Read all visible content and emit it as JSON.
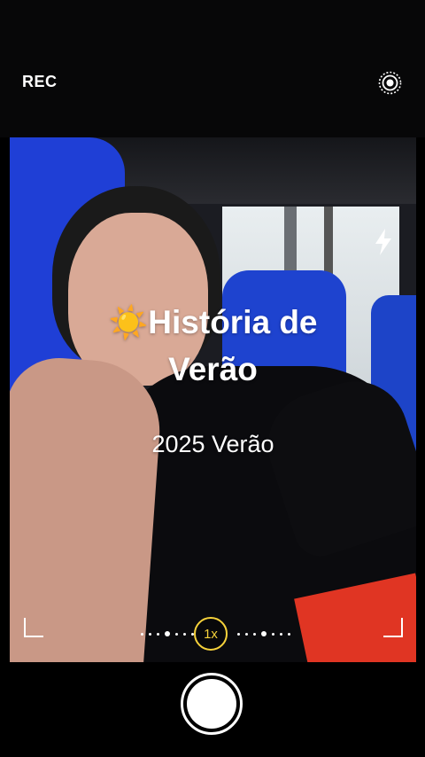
{
  "header": {
    "rec_label": "REC",
    "live_icon": "live-photo-icon"
  },
  "overlay": {
    "title_emoji": "☀️",
    "title_line1": "História de",
    "title_line2": "Verão",
    "subtitle": "2025 Verão"
  },
  "controls": {
    "flash_icon": "flash-icon",
    "zoom_label": "1x",
    "shutter_icon": "shutter-button"
  },
  "colors": {
    "zoom_accent": "#f6d23b",
    "sun": "#f7c21c"
  }
}
